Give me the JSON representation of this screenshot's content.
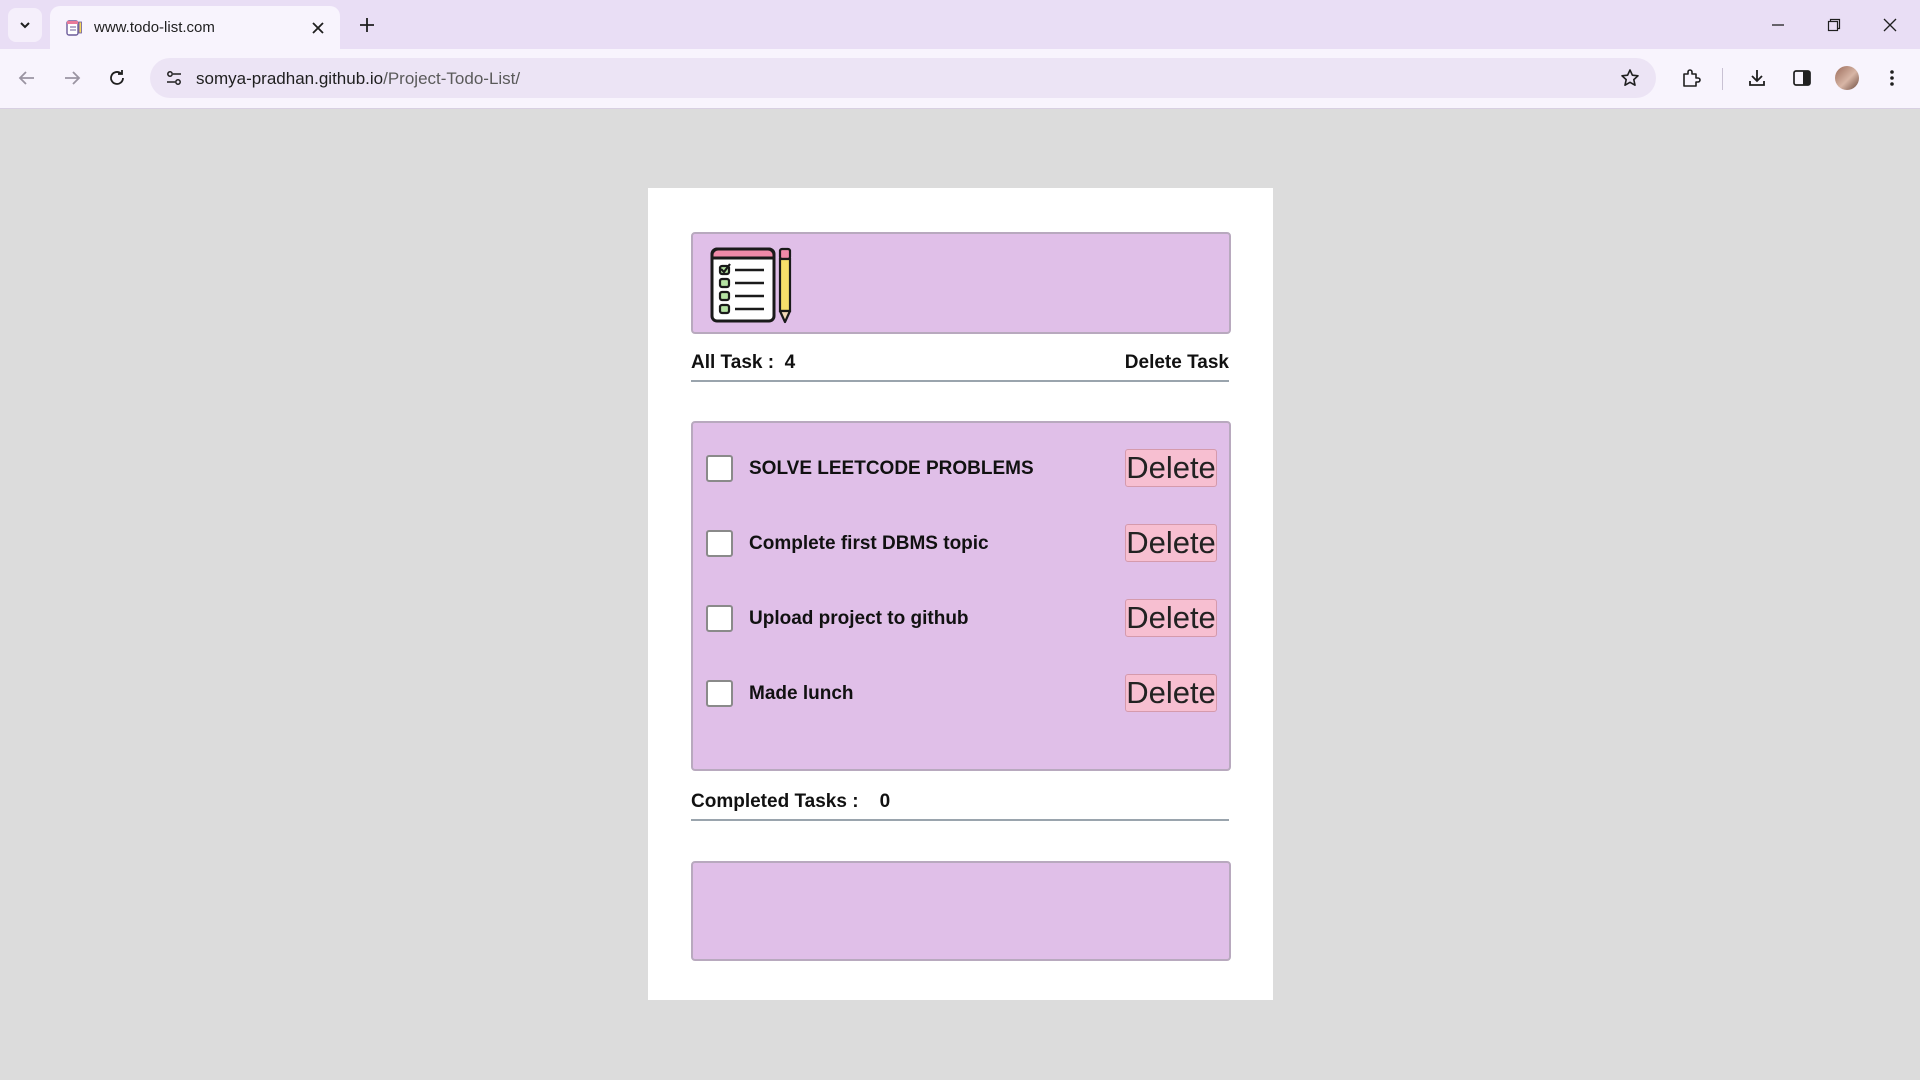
{
  "browser": {
    "tab": {
      "title": "www.todo-list.com"
    },
    "url": {
      "host": "somya-pradhan.github.io",
      "path": "/Project-Todo-List/"
    }
  },
  "colors": {
    "panel": "#e0bfe8",
    "delete_button": "#f7bfd1",
    "page_bg": "#dcdcdc",
    "tabbar_bg": "#e9def5"
  },
  "todo": {
    "all_tasks_label": "All Task :",
    "all_tasks_count": "4",
    "delete_task_label": "Delete Task",
    "tasks": [
      {
        "text": "SOLVE LEETCODE PROBLEMS",
        "done": false,
        "delete_label": "Delete"
      },
      {
        "text": "Complete first DBMS topic",
        "done": false,
        "delete_label": "Delete"
      },
      {
        "text": "Upload project to github",
        "done": false,
        "delete_label": "Delete"
      },
      {
        "text": "Made lunch",
        "done": false,
        "delete_label": "Delete"
      }
    ],
    "completed_label": "Completed Tasks :",
    "completed_count": "0",
    "completed_tasks": []
  }
}
